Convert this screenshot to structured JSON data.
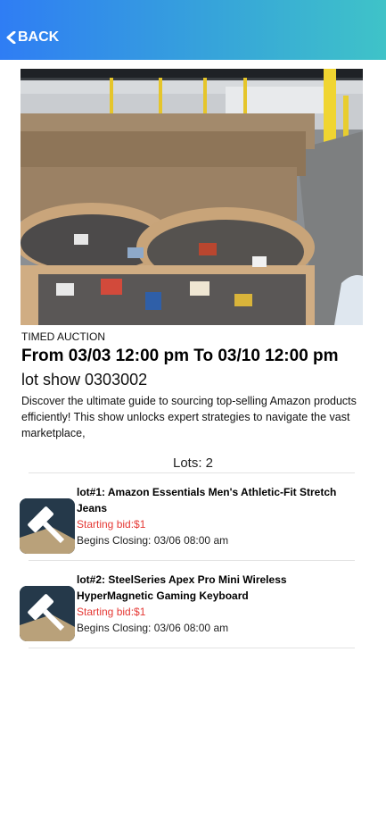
{
  "header": {
    "back_label": "BACK"
  },
  "auction": {
    "type_label": "TIMED AUCTION",
    "dates": "From 03/03 12:00 pm To 03/10 12:00 pm",
    "title": "lot show 0303002",
    "description": "Discover the ultimate guide to sourcing top-selling Amazon products efficiently! This show unlocks expert strategies to navigate the vast marketplace,"
  },
  "lots_count_label": "Lots: 2",
  "lots": [
    {
      "title": "lot#1: Amazon Essentials Men's Athletic-Fit Stretch Jeans",
      "starting_bid": "Starting bid:$1",
      "closing": "Begins Closing: 03/06 08:00 am"
    },
    {
      "title": "lot#2: SteelSeries Apex Pro Mini Wireless HyperMagnetic Gaming Keyboard",
      "starting_bid": "Starting bid:$1",
      "closing": "Begins Closing: 03/06 08:00 am"
    }
  ],
  "colors": {
    "header_gradient_start": "#2f7df4",
    "header_gradient_end": "#3fc3c8",
    "bid_red": "#e53935",
    "thumb_bg": "#25394a"
  }
}
